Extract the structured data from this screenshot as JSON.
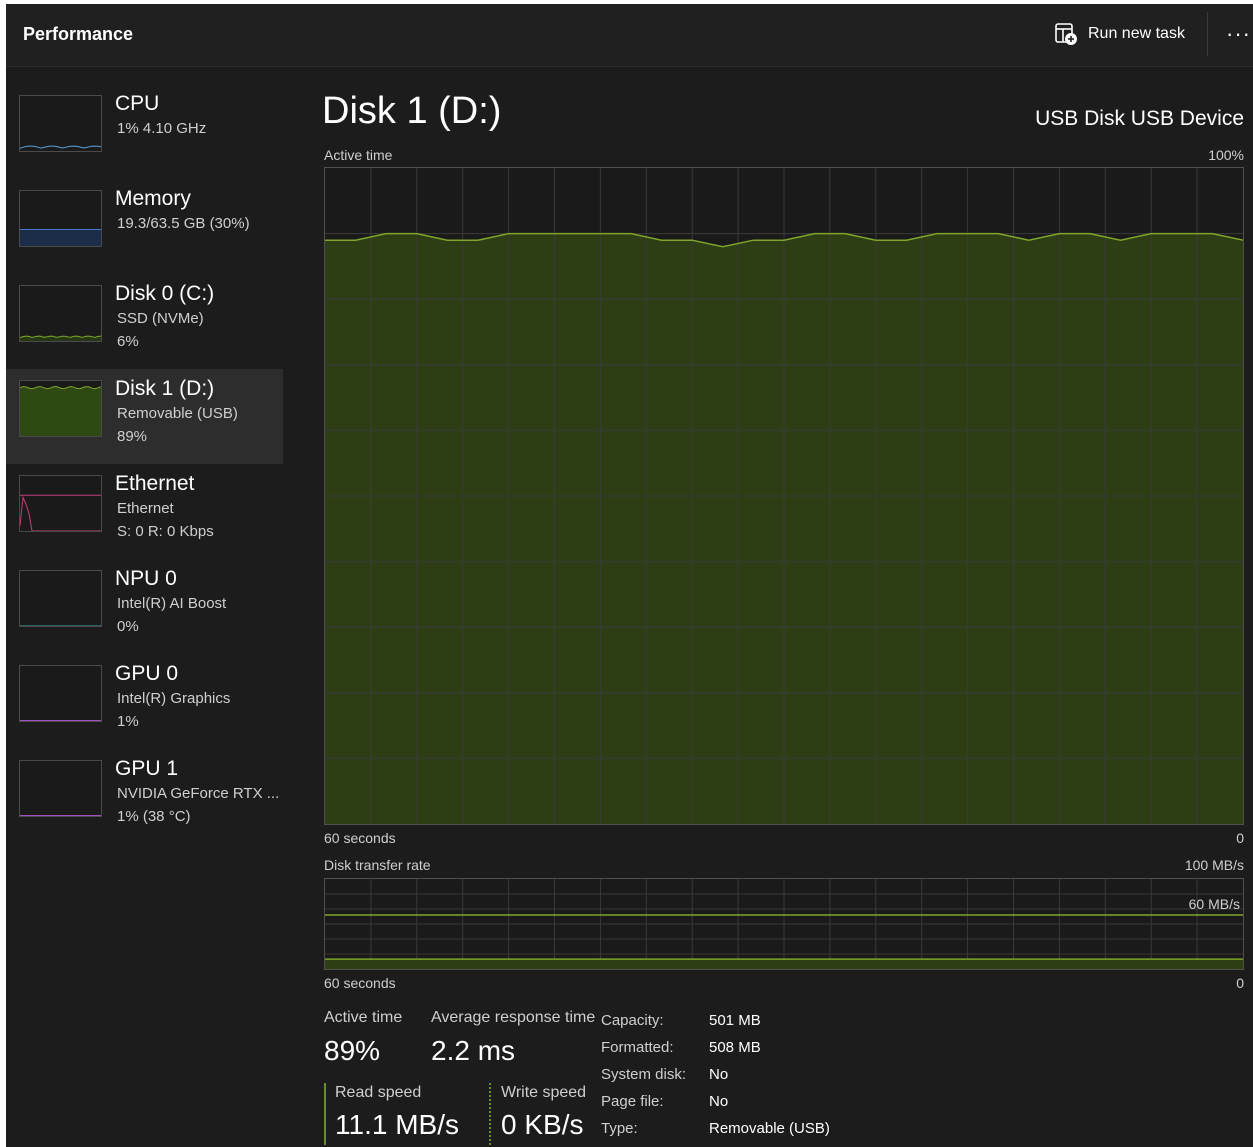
{
  "header": {
    "title": "Performance",
    "run_task_label": "Run new task",
    "more_label": "···"
  },
  "sidebar": {
    "items": [
      {
        "name": "CPU",
        "line1": "1%  4.10 GHz",
        "line2": "",
        "color": "#5aa0d8",
        "selected": false
      },
      {
        "name": "Memory",
        "line1": "19.3/63.5 GB (30%)",
        "line2": "",
        "color": "#4a78c8",
        "selected": false
      },
      {
        "name": "Disk 0 (C:)",
        "line1": "SSD (NVMe)",
        "line2": "6%",
        "color": "#7fa52b",
        "selected": false
      },
      {
        "name": "Disk 1 (D:)",
        "line1": "Removable (USB)",
        "line2": "89%",
        "color": "#7fa52b",
        "selected": true
      },
      {
        "name": "Ethernet",
        "line1": "Ethernet",
        "line2": "S: 0  R: 0 Kbps",
        "color": "#c0407a",
        "selected": false
      },
      {
        "name": "NPU 0",
        "line1": "Intel(R) AI Boost",
        "line2": "0%",
        "color": "#3aa0a0",
        "selected": false
      },
      {
        "name": "GPU 0",
        "line1": "Intel(R) Graphics",
        "line2": "1%",
        "color": "#a050c0",
        "selected": false
      },
      {
        "name": "GPU 1",
        "line1": "NVIDIA GeForce RTX ...",
        "line2": "1%  (38 °C)",
        "color": "#a050c0",
        "selected": false
      }
    ]
  },
  "main": {
    "title": "Disk 1 (D:)",
    "device": "USB Disk USB Device",
    "active_chart": {
      "label": "Active time",
      "max_label": "100%",
      "time_label": "60 seconds",
      "min_label": "0"
    },
    "transfer_chart": {
      "label": "Disk transfer rate",
      "max_label": "100 MB/s",
      "mid_label": "60 MB/s",
      "time_label": "60 seconds",
      "min_label": "0"
    }
  },
  "chart_data": [
    {
      "type": "area",
      "title": "Active time",
      "xlabel": "60 seconds",
      "ylim": [
        0,
        100
      ],
      "y_unit": "%",
      "series": [
        {
          "values": [
            89,
            89,
            90,
            90,
            89,
            89,
            90,
            90,
            90,
            90,
            90,
            89,
            89,
            88,
            89,
            89,
            90,
            90,
            89,
            89,
            90,
            90,
            90,
            89,
            90,
            90,
            89,
            90,
            90,
            90,
            89
          ]
        }
      ]
    },
    {
      "type": "area",
      "title": "Disk transfer rate",
      "xlabel": "60 seconds",
      "ylim": [
        0,
        100
      ],
      "y_unit": "MB/s",
      "reference_line": 60,
      "series": [
        {
          "values": [
            11,
            11,
            11,
            11,
            11,
            11,
            11,
            11,
            11,
            11,
            11,
            11,
            11,
            11,
            11,
            11,
            11,
            11,
            11,
            11,
            11,
            11,
            11,
            11,
            11,
            11,
            11,
            11,
            11,
            11,
            11
          ]
        }
      ]
    }
  ],
  "stats": {
    "active_time_label": "Active time",
    "active_time_value": "89%",
    "avg_response_label": "Average response time",
    "avg_response_value": "2.2 ms",
    "read_speed_label": "Read speed",
    "read_speed_value": "11.1 MB/s",
    "write_speed_label": "Write speed",
    "write_speed_value": "0 KB/s"
  },
  "properties": [
    {
      "key": "Capacity:",
      "value": "501 MB"
    },
    {
      "key": "Formatted:",
      "value": "508 MB"
    },
    {
      "key": "System disk:",
      "value": "No"
    },
    {
      "key": "Page file:",
      "value": "No"
    },
    {
      "key": "Type:",
      "value": "Removable (USB)"
    }
  ],
  "colors": {
    "accent": "#6b8e23",
    "chart_fill": "#2e3e14",
    "chart_line": "#7fa52b",
    "background": "#1c1c1c"
  }
}
